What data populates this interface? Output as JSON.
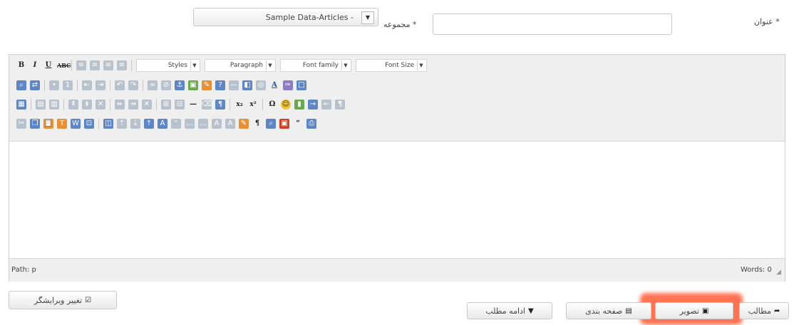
{
  "form": {
    "title_label": "عنوان *",
    "category_label": "مجموعه *",
    "category_value": "Sample Data-Articles - ",
    "title_value": ""
  },
  "toolbar": {
    "styles": "Styles",
    "paragraph": "Paragraph",
    "font_family": "Font family",
    "font_size": "Font Size"
  },
  "editor": {
    "path": "Path: p",
    "words": "Words: 0"
  },
  "buttons": {
    "toggle_editor": "تغییر ویرایشگر",
    "article": "مطالب",
    "image": "تصویر",
    "pagebreak": "صفحه بندی",
    "readmore": "ادامه مطلب"
  },
  "highlight_color": "#ff5b35"
}
